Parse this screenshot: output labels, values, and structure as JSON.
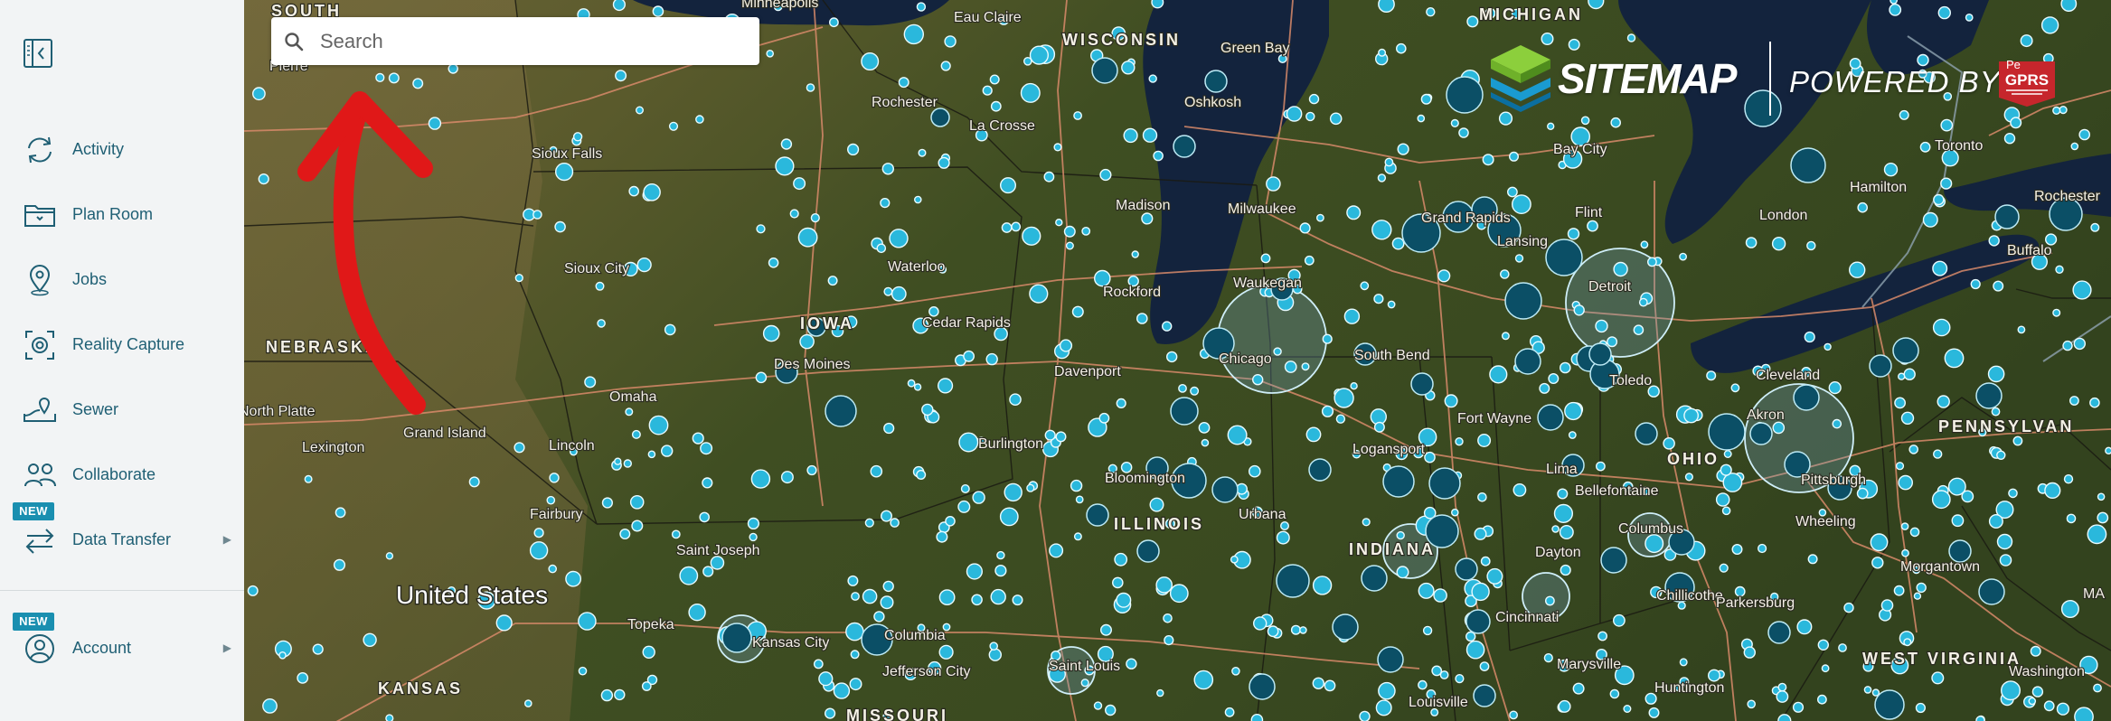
{
  "sidebar": {
    "collapse_icon": "sidebar-collapse-icon",
    "new_badge": "NEW",
    "items": [
      {
        "label": "Activity",
        "icon": "refresh-icon"
      },
      {
        "label": "Plan Room",
        "icon": "folder-icon"
      },
      {
        "label": "Jobs",
        "icon": "map-pin-icon"
      },
      {
        "label": "Reality Capture",
        "icon": "camera-scan-icon"
      },
      {
        "label": "Sewer",
        "icon": "map-route-icon"
      },
      {
        "label": "Collaborate",
        "icon": "people-icon"
      },
      {
        "label": "Data Transfer",
        "icon": "transfer-arrows-icon",
        "badge": "NEW",
        "has_submenu": true
      },
      {
        "label": "Account",
        "icon": "user-icon",
        "badge": "NEW",
        "has_submenu": true
      }
    ]
  },
  "search": {
    "placeholder": "Search",
    "value": ""
  },
  "brand": {
    "name": "SITEMAP",
    "powered_by": "POWERED BY",
    "partner_logo_text": "GPRS",
    "partner_prefix": "Pe"
  },
  "map": {
    "labels": {
      "countries": [
        "United States"
      ],
      "states": [
        "SOUTH",
        "MICHIGAN",
        "WISCONSIN",
        "IOWA",
        "NEBRASKA",
        "ILLINOIS",
        "INDIANA",
        "OHIO",
        "PENNSYLVAN",
        "KANSAS",
        "MISSOURI",
        "WEST VIRGINIA"
      ],
      "cities": [
        "Pierre",
        "Minneapolis",
        "Eau Claire",
        "Green Bay",
        "Oshkosh",
        "Rochester",
        "La Crosse",
        "Sioux Falls",
        "Madison",
        "Milwaukee",
        "Grand Rapids",
        "Bay City",
        "Flint",
        "Lansing",
        "Toronto",
        "Hamilton",
        "London",
        "Rochester",
        "Buffalo",
        "Sioux City",
        "Waterloo",
        "Cedar Rapids",
        "Des Moines",
        "Rockford",
        "Waukegan",
        "Chicago",
        "Detroit",
        "Davenport",
        "Omaha",
        "South Bend",
        "Toledo",
        "Cleveland",
        "Fort Wayne",
        "Akron",
        "Lincoln",
        "Grand Island",
        "Lexington",
        "North Platte",
        "Burlington",
        "Logansport",
        "Bloomington",
        "Urbana",
        "Lima",
        "Bellefontaine",
        "Columbus",
        "Pittsburgh",
        "Wheeling",
        "Fairbury",
        "Saint Joseph",
        "Dayton",
        "Morgantown",
        "Topeka",
        "Kansas City",
        "Columbia",
        "Jefferson City",
        "Saint Louis",
        "Cincinnati",
        "Chillicothe",
        "Parkersburg",
        "Marysville",
        "Huntington",
        "Louisville",
        "Washington",
        "MA"
      ]
    },
    "annotation": "red-arrow-pointing-to-search",
    "colors": {
      "sidebar_bg": "#f2f4f5",
      "nav_text": "#1f5f74",
      "badge_bg": "#1a8fb0",
      "city_dot": "#2ab8dc",
      "annotation_red": "#e01818",
      "lake_water": "#13233d",
      "land": "#3f4e22"
    }
  }
}
